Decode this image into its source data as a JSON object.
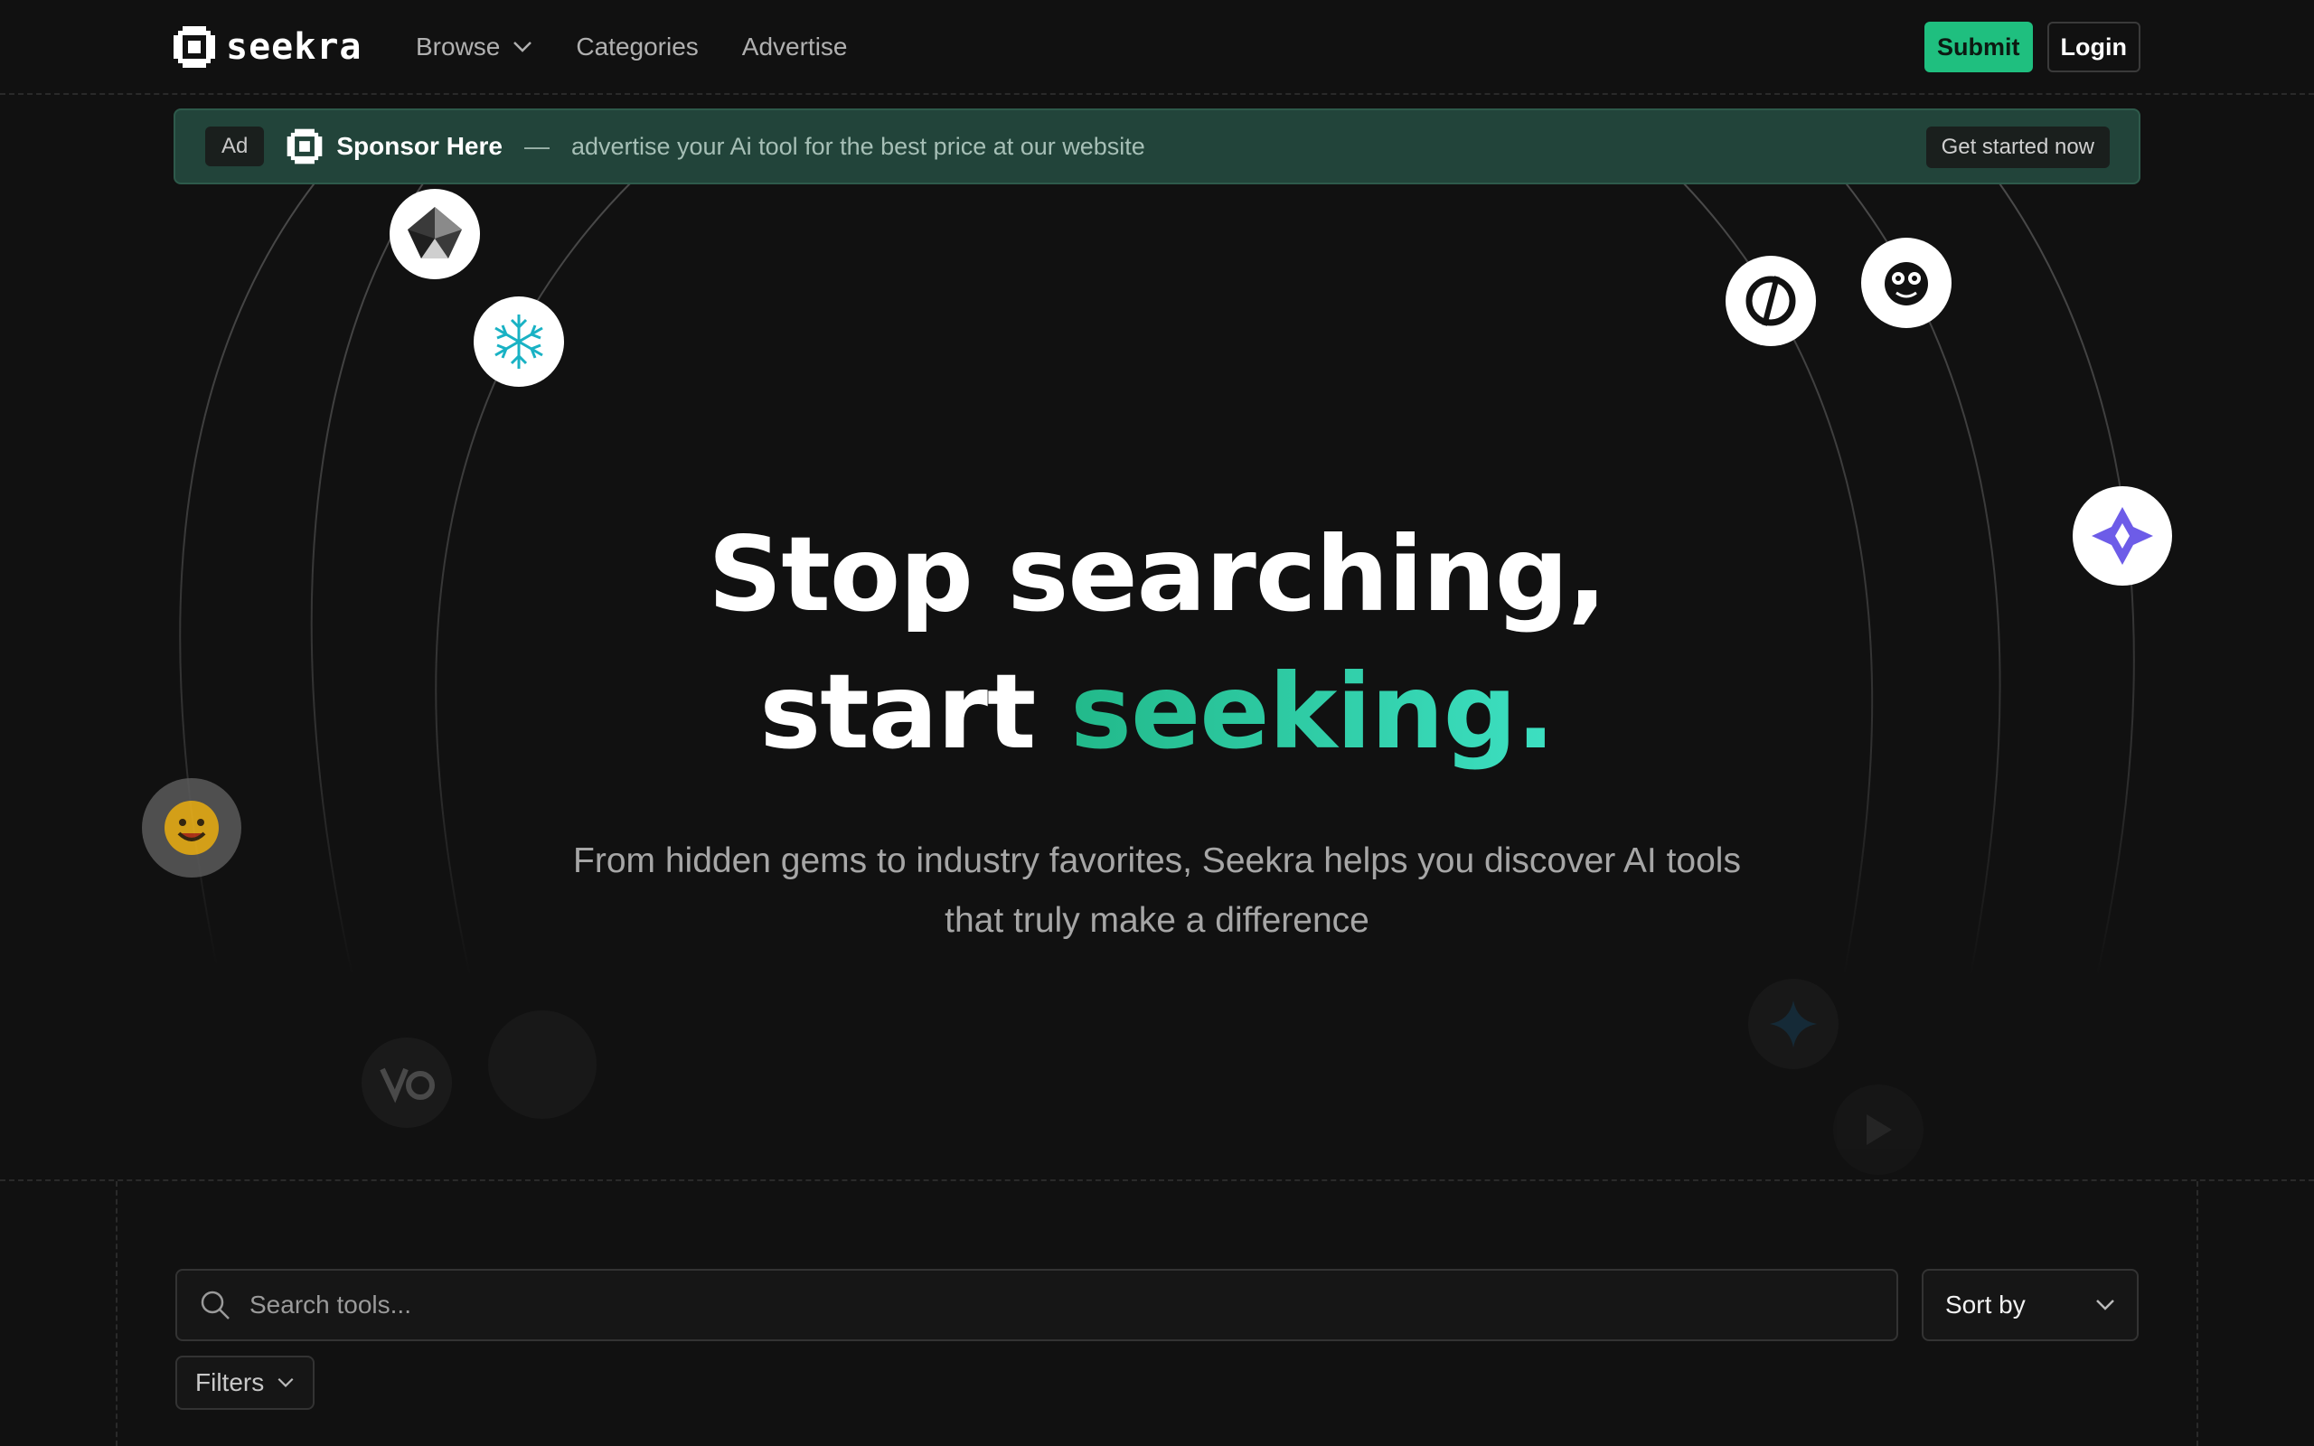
{
  "brand": {
    "name": "seekra"
  },
  "nav": {
    "items": [
      {
        "label": "Browse",
        "has_dropdown": true
      },
      {
        "label": "Categories"
      },
      {
        "label": "Advertise"
      }
    ]
  },
  "header_actions": {
    "submit_label": "Submit",
    "login_label": "Login"
  },
  "ad_banner": {
    "badge": "Ad",
    "title": "Sponsor Here",
    "separator": "—",
    "text": "advertise your Ai tool for the best price at our website",
    "cta_label": "Get started now"
  },
  "hero": {
    "title_line1": "Stop searching,",
    "title_line2_plain": "start ",
    "title_line2_accent": "seeking.",
    "subtitle": "From hidden gems to industry favorites, Seekra helps you discover AI tools that truly make a difference"
  },
  "search": {
    "placeholder": "Search tools..."
  },
  "sort": {
    "label": "Sort by"
  },
  "filters": {
    "label": "Filters"
  },
  "floating_icons": [
    "prism-logo-icon",
    "snowflake-logo-icon",
    "perplexity-logo-icon",
    "mascot-logo-icon",
    "gemini-star-logo-icon",
    "huggingface-logo-icon",
    "ve-logo-icon",
    "blank-logo-icon",
    "sparkle-logo-icon",
    "arrow-logo-icon"
  ],
  "colors": {
    "background": "#111111",
    "accent_green": "#1fbf7f",
    "accent_teal": "#3de0c2",
    "ad_background": "#22443a"
  }
}
